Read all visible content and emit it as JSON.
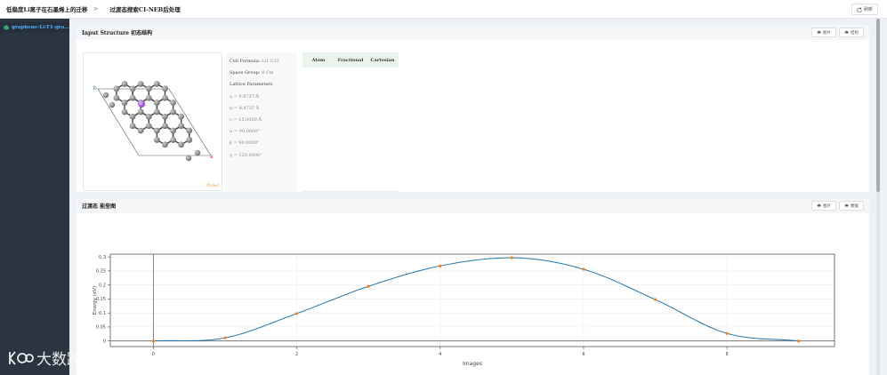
{
  "breadcrumb": {
    "project": "低稳度Li离子在石墨烯上的迁移",
    "current": "过渡态搜索CI-NEB后处理",
    "separator": ">"
  },
  "toolbar": {
    "refresh_label": "刷新",
    "refresh_icon": "refresh-icon"
  },
  "sidebar": {
    "items": [
      {
        "label": "graphene-Li-T1-gra..."
      }
    ]
  },
  "structure_card": {
    "title": "Input Structure 初态结构",
    "btn_image": "图片",
    "btn_download": "结构",
    "panel_label": "Panel",
    "axis_a": "a",
    "axis_b": "b",
    "cell_formula_key": "Cell Formula:",
    "cell_formula_val": "Li1 C32",
    "space_group_key": "Space Group:",
    "space_group_val": "8 Cm",
    "lattice_title": "Lattice Parameters",
    "params": [
      "a = 9.8737 Å",
      "b = 9.8737 Å",
      "c = 15.0000 Å",
      "α = 90.0000°",
      "β = 90.0000°",
      "γ = 120.0000°"
    ],
    "table_headers": [
      "Atom",
      "Fractional",
      "Cartesian"
    ]
  },
  "energy_card": {
    "title": "过渡态 能垒图",
    "btn_image": "图片",
    "btn_data": "数据"
  },
  "chart_data": {
    "type": "line",
    "xlabel": "Images",
    "ylabel": "Energy (eV)",
    "x": [
      0,
      1,
      2,
      3,
      4,
      5,
      6,
      7,
      8,
      9
    ],
    "values": [
      0,
      0.011,
      0.098,
      0.195,
      0.268,
      0.297,
      0.256,
      0.148,
      0.027,
      0
    ],
    "xlim": [
      -0.6,
      9.5
    ],
    "ylim": [
      -0.02,
      0.31
    ],
    "xticks": [
      0,
      2,
      4,
      6,
      8
    ],
    "yticks": [
      0,
      0.05,
      0.1,
      0.15,
      0.2,
      0.25,
      0.3
    ],
    "ytick_labels": [
      "0",
      "0.05",
      "0.1",
      "0.15",
      "0.2",
      "0.25",
      "0.3"
    ],
    "grid": true,
    "line_color": "#1f77b4",
    "marker_color": "#ff7f0e"
  },
  "watermark": {
    "text": "大数跨境"
  }
}
